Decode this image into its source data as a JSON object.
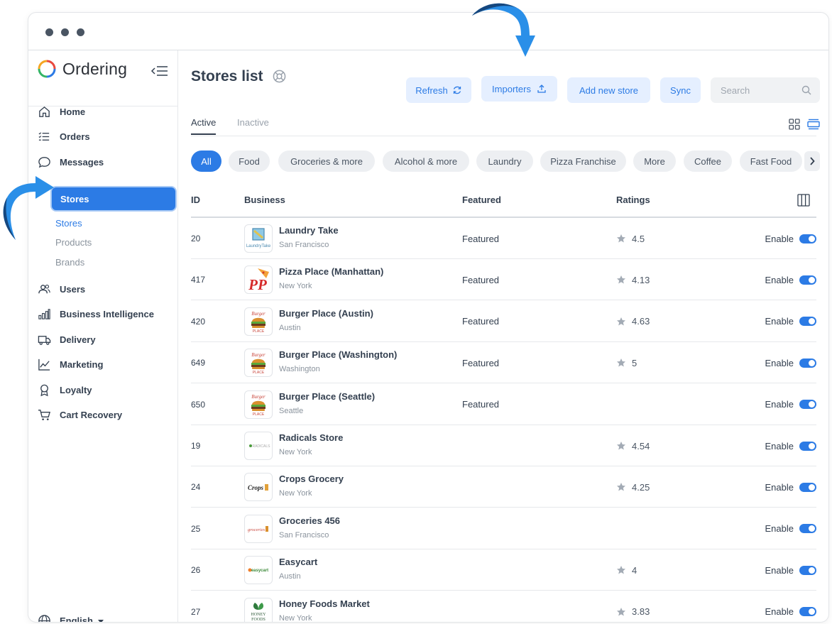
{
  "app": {
    "name": "Ordering"
  },
  "sidebar": {
    "items": [
      {
        "label": "Home",
        "icon": "home-icon"
      },
      {
        "label": "Orders",
        "icon": "list-icon"
      },
      {
        "label": "Messages",
        "icon": "chat-icon"
      },
      {
        "label": "Stores",
        "icon": "store-icon"
      },
      {
        "label": "Users",
        "icon": "users-icon"
      },
      {
        "label": "Business Intelligence",
        "icon": "chart-bar-icon"
      },
      {
        "label": "Delivery",
        "icon": "truck-icon"
      },
      {
        "label": "Marketing",
        "icon": "graph-icon"
      },
      {
        "label": "Loyalty",
        "icon": "award-icon"
      },
      {
        "label": "Cart Recovery",
        "icon": "cart-icon"
      }
    ],
    "sub_items": [
      "Stores",
      "Products",
      "Brands"
    ],
    "language": "English"
  },
  "header": {
    "title": "Stores list",
    "refresh": "Refresh",
    "importers": "Importers",
    "add_store": "Add new store",
    "sync": "Sync",
    "search_placeholder": "Search"
  },
  "tabs": [
    "Active",
    "Inactive"
  ],
  "categories": [
    "All",
    "Food",
    "Groceries & more",
    "Alcohol & more",
    "Laundry",
    "Pizza Franchise",
    "More",
    "Coffee",
    "Fast Food"
  ],
  "table": {
    "headers": [
      "ID",
      "Business",
      "Featured",
      "Ratings"
    ],
    "rows": [
      {
        "id": "20",
        "name": "Laundry Take",
        "city": "San Francisco",
        "featured": "Featured",
        "rating": "4.5",
        "status": "Enable",
        "logo": "LaundryTake"
      },
      {
        "id": "417",
        "name": "Pizza Place (Manhattan)",
        "city": "New York",
        "featured": "Featured",
        "rating": "4.13",
        "status": "Enable",
        "logo": "PP"
      },
      {
        "id": "420",
        "name": "Burger Place (Austin)",
        "city": "Austin",
        "featured": "Featured",
        "rating": "4.63",
        "status": "Enable",
        "logo": "Burger"
      },
      {
        "id": "649",
        "name": "Burger Place (Washington)",
        "city": "Washington",
        "featured": "Featured",
        "rating": "5",
        "status": "Enable",
        "logo": "Burger"
      },
      {
        "id": "650",
        "name": "Burger Place (Seattle)",
        "city": "Seattle",
        "featured": "Featured",
        "rating": "",
        "status": "Enable",
        "logo": "Burger"
      },
      {
        "id": "19",
        "name": "Radicals Store",
        "city": "New York",
        "featured": "",
        "rating": "4.54",
        "status": "Enable",
        "logo": "RADICALS"
      },
      {
        "id": "24",
        "name": "Crops Grocery",
        "city": "New York",
        "featured": "",
        "rating": "4.25",
        "status": "Enable",
        "logo": "Crops"
      },
      {
        "id": "25",
        "name": "Groceries 456",
        "city": "San Francisco",
        "featured": "",
        "rating": "",
        "status": "Enable",
        "logo": "groceries"
      },
      {
        "id": "26",
        "name": "Easycart",
        "city": "Austin",
        "featured": "",
        "rating": "4",
        "status": "Enable",
        "logo": "easycart"
      },
      {
        "id": "27",
        "name": "Honey Foods Market",
        "city": "New York",
        "featured": "",
        "rating": "3.83",
        "status": "Enable",
        "logo": "HONEY FOODS"
      }
    ]
  },
  "colors": {
    "accent": "#2c7be5",
    "accent_light": "#e5efff",
    "text": "#344050",
    "arrow": "#2a8fe8"
  }
}
